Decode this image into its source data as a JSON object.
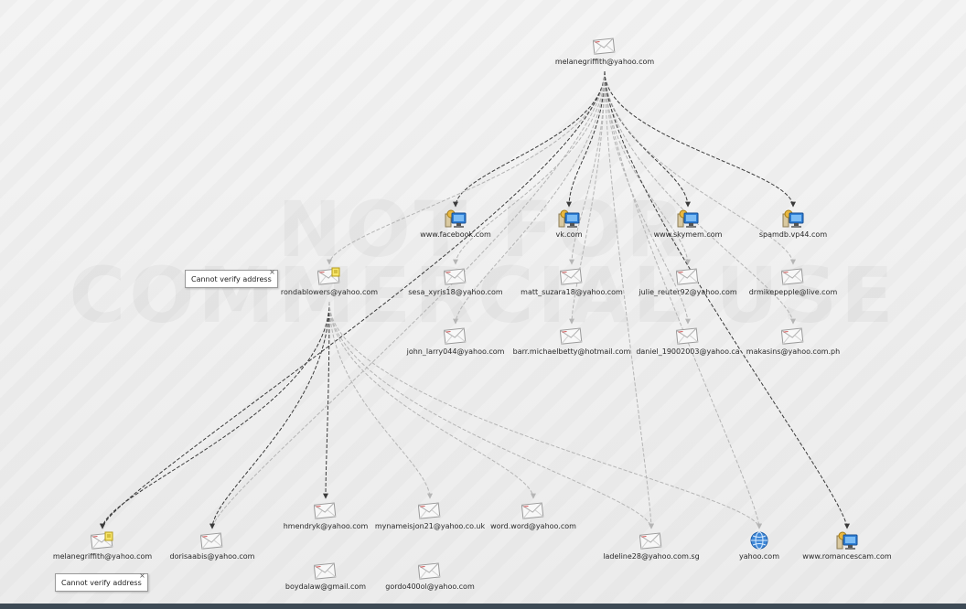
{
  "nodes": [
    {
      "id": "root",
      "label": "melanegriffith@yahoo.com",
      "icon": "envelope-icon"
    },
    {
      "id": "facebook",
      "label": "www.facebook.com",
      "icon": "website-icon"
    },
    {
      "id": "vk",
      "label": "vk.com",
      "icon": "website-icon"
    },
    {
      "id": "skymem",
      "label": "www.skymem.com",
      "icon": "website-icon"
    },
    {
      "id": "spamdb",
      "label": "spamdb.vp44.com",
      "icon": "website-icon"
    },
    {
      "id": "ronda",
      "label": "rondablowers@yahoo.com",
      "icon": "envelope-note-icon"
    },
    {
      "id": "sesa",
      "label": "sesa_xyris18@yahoo.com",
      "icon": "envelope-icon"
    },
    {
      "id": "matt",
      "label": "matt_suzara18@yahoo.com",
      "icon": "envelope-icon"
    },
    {
      "id": "julie",
      "label": "julie_reuter92@yahoo.com",
      "icon": "envelope-icon"
    },
    {
      "id": "drmike",
      "label": "drmikepepple@live.com",
      "icon": "envelope-icon"
    },
    {
      "id": "john",
      "label": "john_larry044@yahoo.com",
      "icon": "envelope-icon"
    },
    {
      "id": "barr",
      "label": "barr.michaelbetty@hotmail.com",
      "icon": "envelope-icon"
    },
    {
      "id": "daniel",
      "label": "daniel_19002003@yahoo.ca",
      "icon": "envelope-icon"
    },
    {
      "id": "makasins",
      "label": "makasins@yahoo.com.ph",
      "icon": "envelope-icon"
    },
    {
      "id": "hmendryk",
      "label": "hmendryk@yahoo.com",
      "icon": "envelope-icon"
    },
    {
      "id": "mynameis",
      "label": "mynameisjon21@yahoo.co.uk",
      "icon": "envelope-icon"
    },
    {
      "id": "word",
      "label": "word.word@yahoo.com",
      "icon": "envelope-icon"
    },
    {
      "id": "melane2",
      "label": "melanegriffith@yahoo.com",
      "icon": "envelope-note-icon"
    },
    {
      "id": "dorisa",
      "label": "dorisaabis@yahoo.com",
      "icon": "envelope-icon"
    },
    {
      "id": "ladeline",
      "label": "ladeline28@yahoo.com.sg",
      "icon": "envelope-icon"
    },
    {
      "id": "yahoo",
      "label": "yahoo.com",
      "icon": "globe-icon"
    },
    {
      "id": "romance",
      "label": "www.romancescam.com",
      "icon": "website-icon"
    },
    {
      "id": "boyda",
      "label": "boydalaw@gmail.com",
      "icon": "envelope-icon"
    },
    {
      "id": "gordo",
      "label": "gordo400ol@yahoo.com",
      "icon": "envelope-icon"
    }
  ],
  "edges": [
    [
      "root",
      "facebook"
    ],
    [
      "root",
      "vk"
    ],
    [
      "root",
      "skymem"
    ],
    [
      "root",
      "spamdb"
    ],
    [
      "root",
      "ronda"
    ],
    [
      "root",
      "sesa"
    ],
    [
      "root",
      "matt"
    ],
    [
      "root",
      "julie"
    ],
    [
      "root",
      "drmike"
    ],
    [
      "root",
      "john"
    ],
    [
      "root",
      "barr"
    ],
    [
      "root",
      "daniel"
    ],
    [
      "root",
      "makasins"
    ],
    [
      "root",
      "melane2"
    ],
    [
      "root",
      "dorisa"
    ],
    [
      "root",
      "ladeline"
    ],
    [
      "root",
      "yahoo"
    ],
    [
      "root",
      "romance"
    ],
    [
      "ronda",
      "melane2"
    ],
    [
      "ronda",
      "dorisa"
    ],
    [
      "ronda",
      "hmendryk"
    ],
    [
      "ronda",
      "mynameis"
    ],
    [
      "ronda",
      "word"
    ],
    [
      "ronda",
      "yahoo"
    ],
    [
      "ronda",
      "ladeline"
    ]
  ],
  "tooltips": {
    "ronda": {
      "text": "Cannot verify address",
      "close": "×"
    },
    "melane2": {
      "text": "Cannot verify address",
      "close": "×"
    }
  },
  "watermark": [
    "NOT FOR",
    "COMMERCIAL USE"
  ],
  "colors": {
    "edge_dark": "#3a3a3a",
    "edge_light": "#b5b5b5",
    "label": "#2a2a2a"
  }
}
